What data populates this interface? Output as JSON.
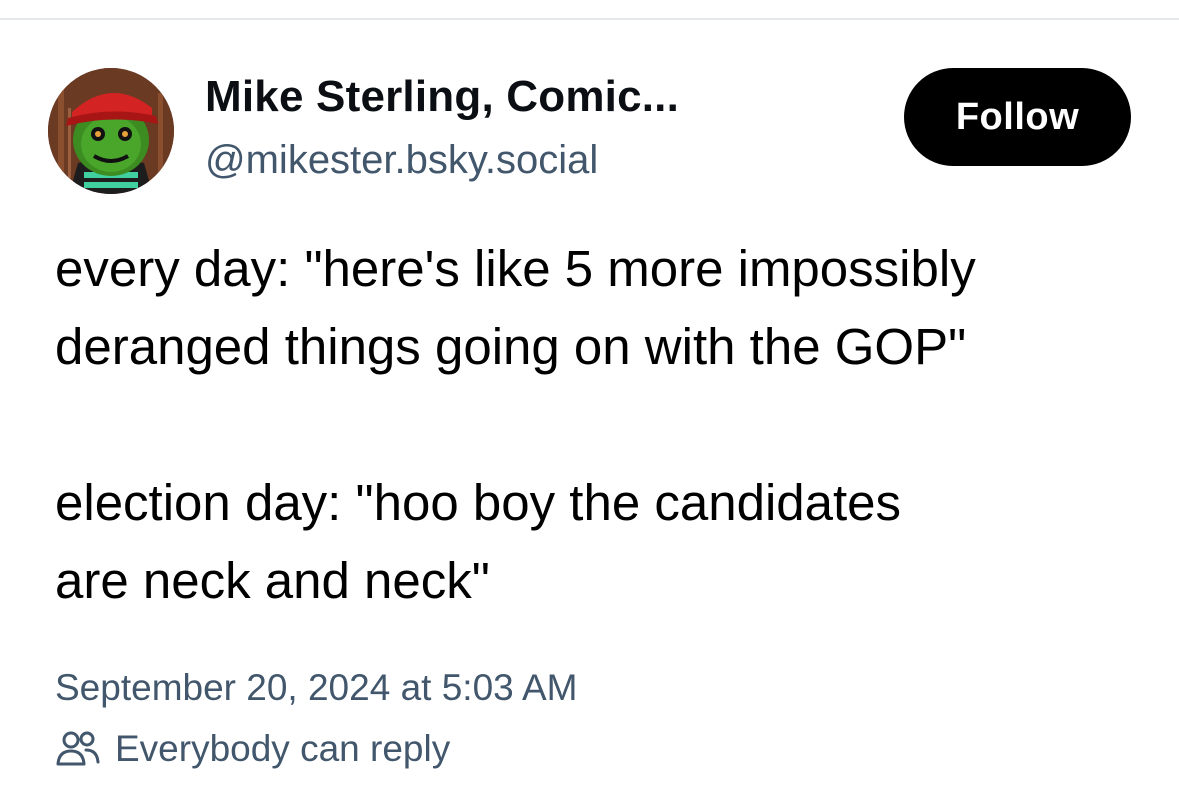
{
  "author": {
    "display_name": "Mike Sterling, Comic...",
    "handle": "@mikester.bsky.social",
    "avatar_icon": "avatar-green-goblin-red-cap"
  },
  "follow_button": {
    "label": "Follow"
  },
  "post": {
    "paragraphs": [
      {
        "lines": [
          "every day: \"here's like 5 more impossibly",
          "deranged things going on with the GOP\""
        ]
      },
      {
        "lines": [
          "election day: \"hoo boy the candidates",
          "are neck and neck\""
        ]
      }
    ],
    "timestamp": "September 20, 2024 at 5:03 AM",
    "reply_setting": "Everybody can reply",
    "reply_icon": "people-icon"
  },
  "colors": {
    "text_primary": "#000000",
    "text_secondary": "#42576c",
    "button_bg": "#000000",
    "button_text": "#ffffff",
    "divider": "#e6e9ec"
  }
}
